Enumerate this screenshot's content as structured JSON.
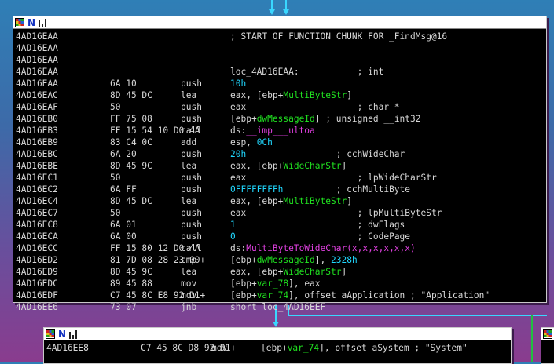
{
  "window_icons": [
    "grid-icon",
    "n-icon",
    "bars-icon"
  ],
  "colors": {
    "text": "#d8d8d8",
    "number": "#20d8ff",
    "symbol": "#20e020",
    "import": "#e040e0",
    "edge": "#39d7ff"
  },
  "main_block": {
    "rows": [
      {
        "addr": "4AD16EAA",
        "bytes": "",
        "mnem": "",
        "ops": [
          {
            "t": "; START OF FUNCTION CHUNK FOR _FindMsg@16",
            "c": ""
          }
        ]
      },
      {
        "addr": "4AD16EAA",
        "bytes": "",
        "mnem": "",
        "ops": []
      },
      {
        "addr": "4AD16EAA",
        "bytes": "",
        "mnem": "",
        "ops": []
      },
      {
        "addr": "4AD16EAA",
        "bytes": "",
        "mnem": "",
        "ops": [
          {
            "t": "loc_4AD16EAA:           ; int",
            "c": ""
          }
        ]
      },
      {
        "addr": "4AD16EAA",
        "bytes": "6A 10",
        "mnem": "push",
        "ops": [
          {
            "t": "10h",
            "c": "kw"
          }
        ]
      },
      {
        "addr": "4AD16EAC",
        "bytes": "8D 45 DC",
        "mnem": "lea",
        "ops": [
          {
            "t": "eax, [ebp+",
            "c": ""
          },
          {
            "t": "MultiByteStr",
            "c": "sym"
          },
          {
            "t": "]",
            "c": ""
          }
        ]
      },
      {
        "addr": "4AD16EAF",
        "bytes": "50",
        "mnem": "push",
        "ops": [
          {
            "t": "eax                     ; char *",
            "c": ""
          }
        ]
      },
      {
        "addr": "4AD16EB0",
        "bytes": "FF 75 08",
        "mnem": "push",
        "ops": [
          {
            "t": "[ebp+",
            "c": ""
          },
          {
            "t": "dwMessageId",
            "c": "sym"
          },
          {
            "t": "] ; unsigned __int32",
            "c": ""
          }
        ]
      },
      {
        "addr": "4AD16EB3",
        "bytes": "FF 15 54 10 D0 4A",
        "mnem": "call",
        "ops": [
          {
            "t": "ds:",
            "c": ""
          },
          {
            "t": "__imp___ultoa",
            "c": "fn"
          }
        ]
      },
      {
        "addr": "4AD16EB9",
        "bytes": "83 C4 0C",
        "mnem": "add",
        "ops": [
          {
            "t": "esp, ",
            "c": ""
          },
          {
            "t": "0Ch",
            "c": "kw"
          }
        ]
      },
      {
        "addr": "4AD16EBC",
        "bytes": "6A 20",
        "mnem": "push",
        "ops": [
          {
            "t": "20h",
            "c": "kw"
          },
          {
            "t": "                 ; cchWideChar",
            "c": ""
          }
        ]
      },
      {
        "addr": "4AD16EBE",
        "bytes": "8D 45 9C",
        "mnem": "lea",
        "ops": [
          {
            "t": "eax, [ebp+",
            "c": ""
          },
          {
            "t": "WideCharStr",
            "c": "sym"
          },
          {
            "t": "]",
            "c": ""
          }
        ]
      },
      {
        "addr": "4AD16EC1",
        "bytes": "50",
        "mnem": "push",
        "ops": [
          {
            "t": "eax                     ; lpWideCharStr",
            "c": ""
          }
        ]
      },
      {
        "addr": "4AD16EC2",
        "bytes": "6A FF",
        "mnem": "push",
        "ops": [
          {
            "t": "0FFFFFFFFh",
            "c": "kw"
          },
          {
            "t": "          ; cchMultiByte",
            "c": ""
          }
        ]
      },
      {
        "addr": "4AD16EC4",
        "bytes": "8D 45 DC",
        "mnem": "lea",
        "ops": [
          {
            "t": "eax, [ebp+",
            "c": ""
          },
          {
            "t": "MultiByteStr",
            "c": "sym"
          },
          {
            "t": "]",
            "c": ""
          }
        ]
      },
      {
        "addr": "4AD16EC7",
        "bytes": "50",
        "mnem": "push",
        "ops": [
          {
            "t": "eax                     ; lpMultiByteStr",
            "c": ""
          }
        ]
      },
      {
        "addr": "4AD16EC8",
        "bytes": "6A 01",
        "mnem": "push",
        "ops": [
          {
            "t": "1",
            "c": "kw"
          },
          {
            "t": "                       ; dwFlags",
            "c": ""
          }
        ]
      },
      {
        "addr": "4AD16ECA",
        "bytes": "6A 00",
        "mnem": "push",
        "ops": [
          {
            "t": "0",
            "c": "kw"
          },
          {
            "t": "                       ; CodePage",
            "c": ""
          }
        ]
      },
      {
        "addr": "4AD16ECC",
        "bytes": "FF 15 80 12 D0 4A",
        "mnem": "call",
        "ops": [
          {
            "t": "ds:",
            "c": ""
          },
          {
            "t": "MultiByteToWideChar(x,x,x,x,x,x)",
            "c": "fn"
          }
        ]
      },
      {
        "addr": "4AD16ED2",
        "bytes": "81 7D 08 28 23 00+",
        "mnem": "cmp",
        "ops": [
          {
            "t": "[ebp+",
            "c": ""
          },
          {
            "t": "dwMessageId",
            "c": "sym"
          },
          {
            "t": "], ",
            "c": ""
          },
          {
            "t": "2328h",
            "c": "kw"
          }
        ]
      },
      {
        "addr": "4AD16ED9",
        "bytes": "8D 45 9C",
        "mnem": "lea",
        "ops": [
          {
            "t": "eax, [ebp+",
            "c": ""
          },
          {
            "t": "WideCharStr",
            "c": "sym"
          },
          {
            "t": "]",
            "c": ""
          }
        ]
      },
      {
        "addr": "4AD16EDC",
        "bytes": "89 45 88",
        "mnem": "mov",
        "ops": [
          {
            "t": "[ebp+",
            "c": ""
          },
          {
            "t": "var_78",
            "c": "sym"
          },
          {
            "t": "], eax",
            "c": ""
          }
        ]
      },
      {
        "addr": "4AD16EDF",
        "bytes": "C7 45 8C E8 92 D1+",
        "mnem": "mov",
        "ops": [
          {
            "t": "[ebp+",
            "c": ""
          },
          {
            "t": "var_74",
            "c": "sym"
          },
          {
            "t": "], offset aApplication ; \"Application\"",
            "c": ""
          }
        ]
      },
      {
        "addr": "4AD16EE6",
        "bytes": "73 07",
        "mnem": "jnb",
        "ops": [
          {
            "t": "short loc_4AD16EEF",
            "c": ""
          }
        ]
      }
    ]
  },
  "bottom_block": {
    "rows": [
      {
        "addr": "4AD16EE8",
        "bytes": "C7 45 8C D8 92 D1+",
        "mnem": "mov",
        "ops": [
          {
            "t": "[ebp+",
            "c": ""
          },
          {
            "t": "var_74",
            "c": "sym"
          },
          {
            "t": "], offset aSystem ; \"System\"",
            "c": ""
          }
        ]
      }
    ]
  }
}
